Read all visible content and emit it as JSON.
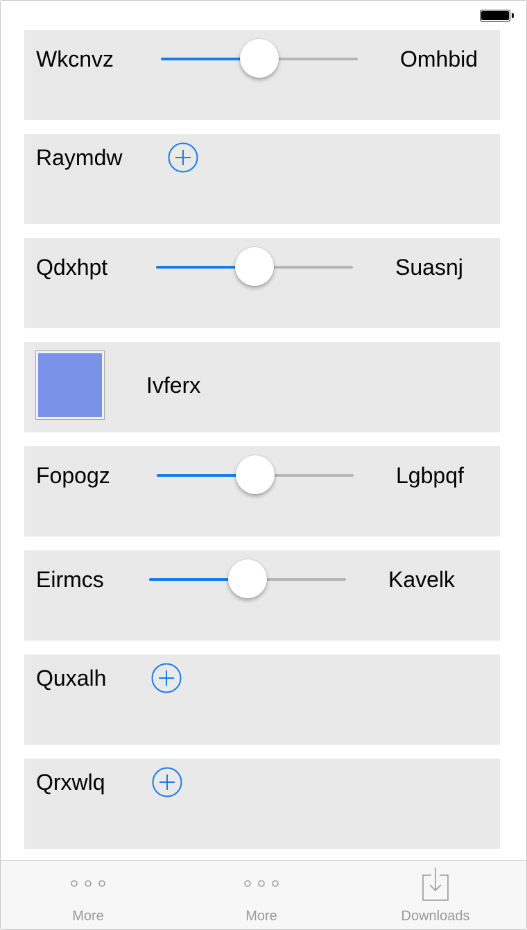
{
  "colors": {
    "accent": "#1a7bea",
    "card_background": "#e9e9e9",
    "track_inactive": "#b6b6b6",
    "swatch": "#7a92e8",
    "tab_inactive": "#9a9a9a"
  },
  "rows": {
    "r1": {
      "type": "slider",
      "left_label": "Wkcnvz",
      "right_label": "Omhbid",
      "value": 0.5
    },
    "r2": {
      "type": "add",
      "label": "Raymdw",
      "icon": "plus-circle-icon"
    },
    "r3": {
      "type": "slider",
      "left_label": "Qdxhpt",
      "right_label": "Suasnj",
      "value": 0.5
    },
    "r4": {
      "type": "swatch",
      "label": "Ivferx"
    },
    "r5": {
      "type": "slider",
      "left_label": "Fopogz",
      "right_label": "Lgbpqf",
      "value": 0.5
    },
    "r6": {
      "type": "slider",
      "left_label": "Eirmcs",
      "right_label": "Kavelk",
      "value": 0.5
    },
    "r7": {
      "type": "add",
      "label": "Quxalh",
      "icon": "plus-circle-icon"
    },
    "r8": {
      "type": "add",
      "label": "Qrxwlq",
      "icon": "plus-circle-icon"
    }
  },
  "tab_bar": {
    "tabs": [
      {
        "label": "More",
        "icon": "more-dots-icon"
      },
      {
        "label": "More",
        "icon": "more-dots-icon"
      },
      {
        "label": "Downloads",
        "icon": "download-tray-icon"
      }
    ]
  },
  "status_bar": {
    "battery_icon": "battery-icon"
  }
}
